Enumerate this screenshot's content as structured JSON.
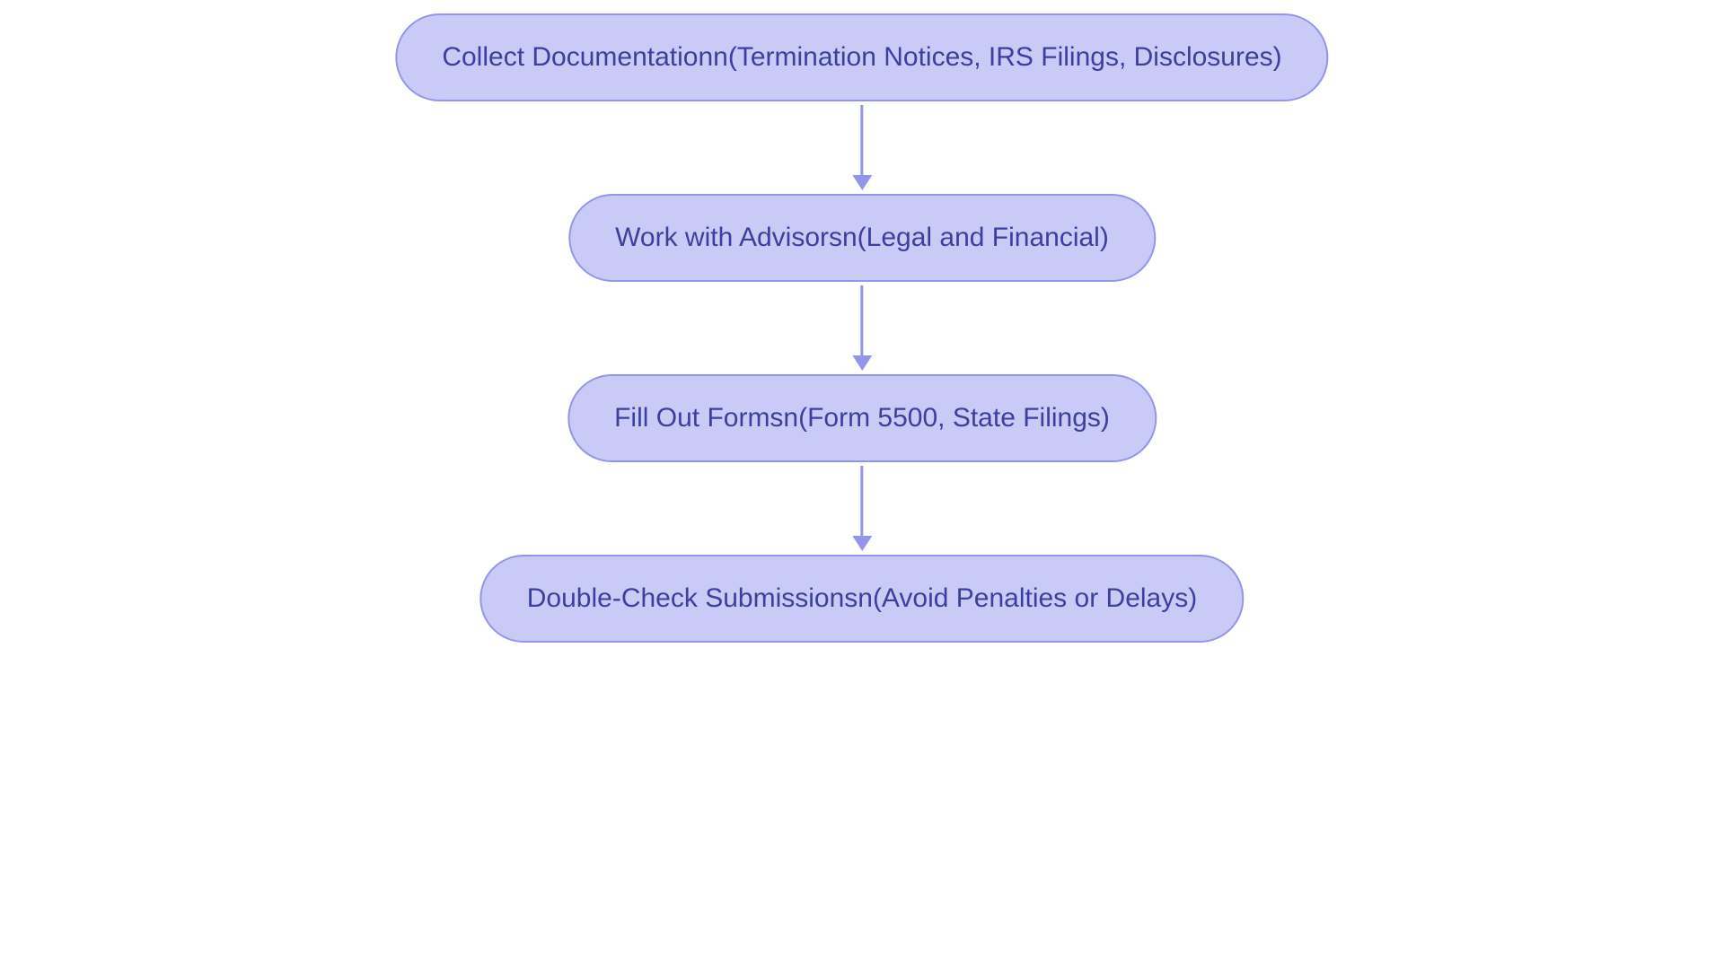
{
  "diagram": {
    "nodes": [
      {
        "label": "Collect Documentationn(Termination Notices, IRS Filings, Disclosures)"
      },
      {
        "label": "Work with Advisorsn(Legal and Financial)"
      },
      {
        "label": "Fill Out Formsn(Form 5500, State Filings)"
      },
      {
        "label": "Double-Check Submissionsn(Avoid Penalties or Delays)"
      }
    ],
    "colors": {
      "node_fill": "#c9caf6",
      "node_border": "#9395eb",
      "text": "#3b3f9f",
      "arrow": "#9395eb"
    }
  }
}
